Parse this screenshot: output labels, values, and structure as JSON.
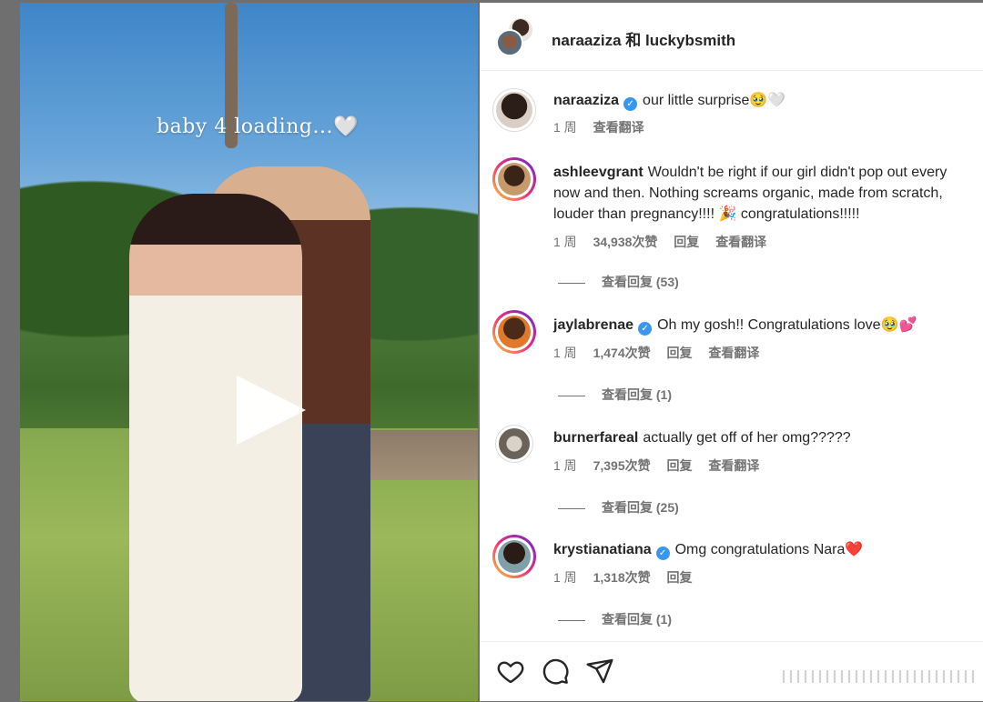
{
  "post": {
    "caption_overlay": "baby 4 loading...🤍",
    "header_title": "naraaziza 和 luckybsmith"
  },
  "comments": [
    {
      "username": "naraaziza",
      "verified": true,
      "text": "our little surprise🥹🤍",
      "time": "1 周",
      "translate": "查看翻译"
    },
    {
      "username": "ashleevgrant",
      "verified": false,
      "text": "Wouldn't be right if our girl didn't pop out every now and then. Nothing screams organic, made from scratch, louder than pregnancy!!!! 🎉 congratulations!!!!!",
      "time": "1 周",
      "likes": "34,938次赞",
      "reply": "回复",
      "translate": "查看翻译",
      "view_replies": "查看回复 (53)"
    },
    {
      "username": "jaylabrenae",
      "verified": true,
      "text": "Oh my gosh!! Congratulations love🥹💕",
      "time": "1 周",
      "likes": "1,474次赞",
      "reply": "回复",
      "translate": "查看翻译",
      "view_replies": "查看回复 (1)"
    },
    {
      "username": "burnerfareal",
      "verified": false,
      "text": "actually get off of her omg?????",
      "time": "1 周",
      "likes": "7,395次赞",
      "reply": "回复",
      "translate": "查看翻译",
      "view_replies": "查看回复 (25)"
    },
    {
      "username": "krystianatiana",
      "verified": true,
      "text": "Omg congratulations Nara❤️",
      "time": "1 周",
      "likes": "1,318次赞",
      "reply": "回复",
      "view_replies": "查看回复 (1)"
    }
  ],
  "icons": {
    "like": "heart-icon",
    "comment": "comment-icon",
    "share": "send-icon",
    "play": "play-icon"
  }
}
